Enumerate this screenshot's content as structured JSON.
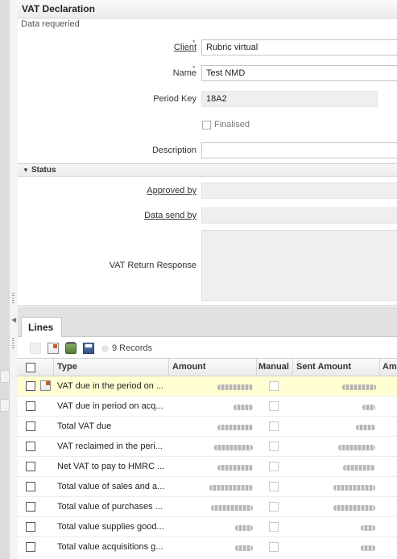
{
  "window": {
    "title": "VAT Declaration",
    "subtitle": "Data requeried"
  },
  "form": {
    "client": {
      "label": "Client",
      "required_mark": "*",
      "value": "Rubric virtual"
    },
    "name": {
      "label": "Name",
      "required_mark": "*",
      "value": "Test NMD"
    },
    "period_key": {
      "label": "Period Key",
      "value": "18A2"
    },
    "finalised": {
      "label": "Finalised",
      "checked": false
    },
    "description": {
      "label": "Description",
      "value": ""
    }
  },
  "status_section": {
    "title": "Status",
    "approved_by": {
      "label": "Approved by",
      "value": ""
    },
    "data_send_by": {
      "label": "Data send by",
      "value": ""
    },
    "vat_return_response": {
      "label": "VAT Return Response",
      "value": ""
    }
  },
  "lines": {
    "tab_label": "Lines",
    "record_count": "9 Records",
    "columns": [
      "Type",
      "Amount",
      "Manual",
      "Sent Amount",
      "Am"
    ],
    "rows": [
      {
        "type": "VAT due in the period on ...",
        "selected": true
      },
      {
        "type": "VAT due in period on acq...",
        "selected": false
      },
      {
        "type": "Total VAT due",
        "selected": false
      },
      {
        "type": "VAT reclaimed in the peri...",
        "selected": false
      },
      {
        "type": "Net VAT to pay to HMRC ...",
        "selected": false
      },
      {
        "type": "Total value of sales and a...",
        "selected": false
      },
      {
        "type": "Total value of purchases ...",
        "selected": false
      },
      {
        "type": "Total value supplies good...",
        "selected": false
      },
      {
        "type": "Total value acquisitions g...",
        "selected": false
      }
    ]
  },
  "icons": [
    "new-record-icon",
    "edit-icon",
    "archive-icon",
    "save-icon",
    "collapse-triangle-icon",
    "splitter-arrow-icon"
  ],
  "colors": {
    "selected_row": "#ffffd2",
    "accent_edit": "#c95f2c"
  }
}
